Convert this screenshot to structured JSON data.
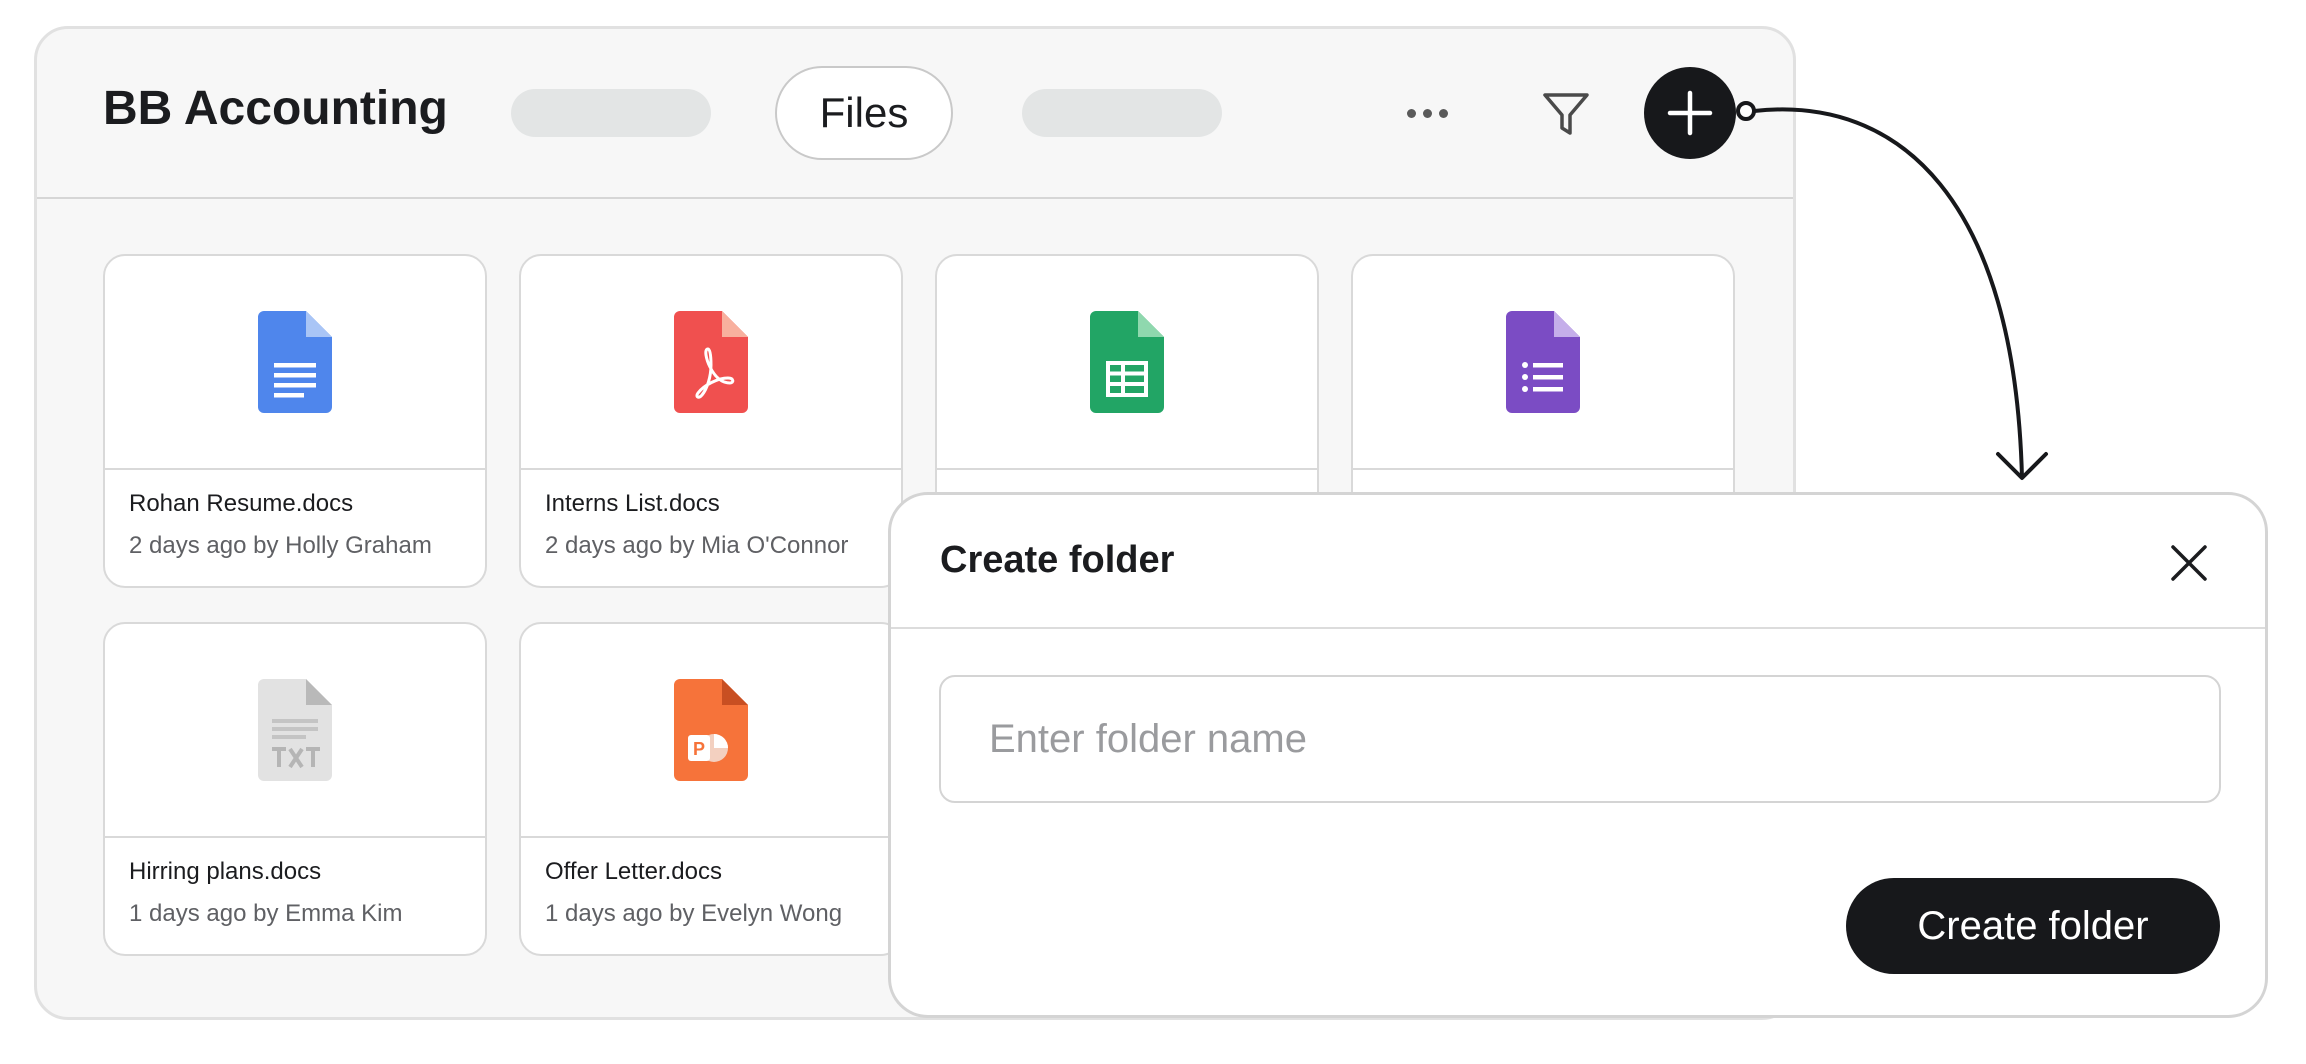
{
  "app": {
    "title": "BB Accounting",
    "active_tab": "Files"
  },
  "icons": {
    "more": "more-horizontal-icon",
    "filter": "filter-icon",
    "add": "plus-icon",
    "close": "close-icon"
  },
  "files": [
    {
      "name": "Rohan Resume.docs",
      "meta": "2 days ago by Holly Graham",
      "type": "doc",
      "color": "#4f86ec"
    },
    {
      "name": "Interns List.docs",
      "meta": "2 days ago by Mia O'Connor",
      "type": "pdf",
      "color": "#f0504f"
    },
    {
      "name": "",
      "meta": "",
      "type": "sheet",
      "color": "#22a565"
    },
    {
      "name": "",
      "meta": "",
      "type": "list",
      "color": "#7b4cc4"
    },
    {
      "name": "Hirring plans.docs",
      "meta": "1 days ago by Emma Kim",
      "type": "txt",
      "color": "#e0e0e0"
    },
    {
      "name": "Offer Letter.docs",
      "meta": "1 days ago by Evelyn Wong",
      "type": "ppt",
      "color": "#f6733a"
    }
  ],
  "dialog": {
    "title": "Create folder",
    "input_placeholder": "Enter folder name",
    "input_value": "",
    "submit_label": "Create folder"
  },
  "colors": {
    "primary": "#17181b",
    "doc_blue": "#4f86ec",
    "pdf_red": "#f0504f",
    "sheet_green": "#22a565",
    "form_purple": "#7b4cc4",
    "ppt_orange": "#f6733a",
    "txt_gray": "#e0e0e0"
  }
}
